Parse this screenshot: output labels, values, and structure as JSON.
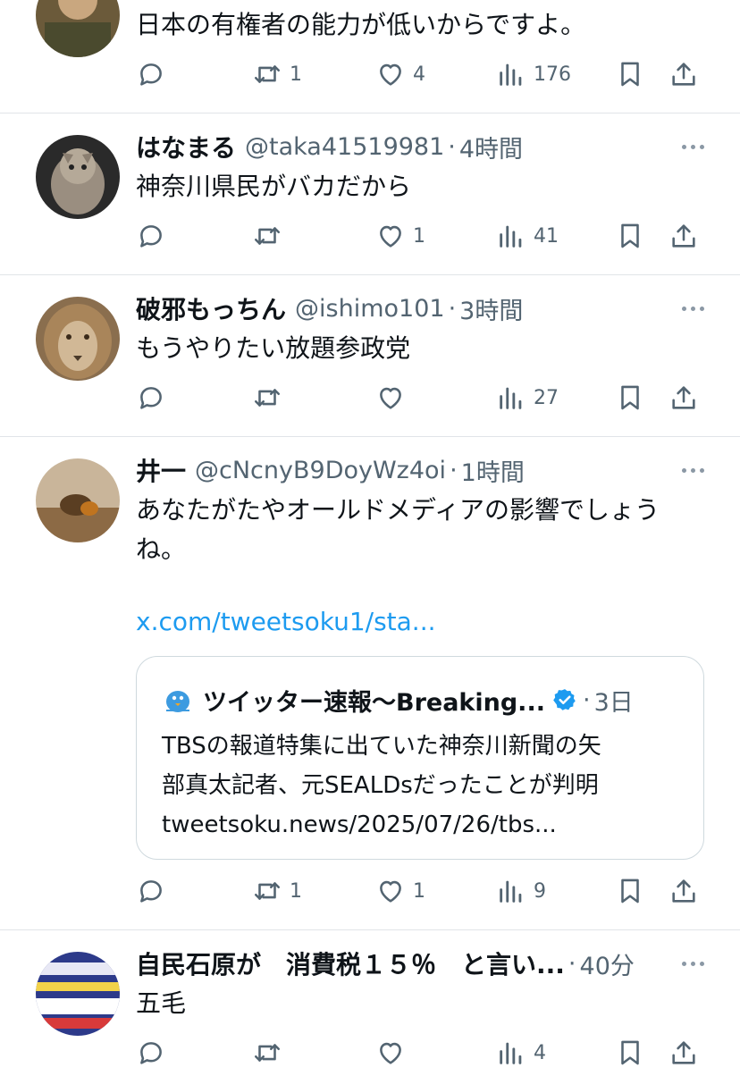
{
  "tweets": [
    {
      "name": "",
      "handle": "",
      "time": "",
      "text": "日本の有権者の能力が低いからですよ。",
      "reply": "",
      "retweets": "1",
      "likes": "4",
      "views": "176"
    },
    {
      "name": "はなまる",
      "handle": "@taka41519981",
      "time": "4時間",
      "text": "神奈川県民がバカだから",
      "reply": "",
      "retweets": "",
      "likes": "1",
      "views": "41"
    },
    {
      "name": "破邪もっちん",
      "handle": "@ishimo101",
      "time": "3時間",
      "text": "もうやりたい放題参政党",
      "reply": "",
      "retweets": "",
      "likes": "",
      "views": "27"
    },
    {
      "name": "井一",
      "handle": "@cNcnyB9DoyWz4oi",
      "time": "1時間",
      "text_line1": "あなたがたやオールドメディアの影響でしょう",
      "text_line2": "ね。",
      "link": "x.com/tweetsoku1/sta...",
      "quote": {
        "name": "ツイッター速報〜Breaking...",
        "time": "3日",
        "line1": "TBSの報道特集に出ていた神奈川新聞の矢",
        "line2": "部真太記者、元SEALDsだったことが判明",
        "line3": "tweetsoku.news/2025/07/26/tbs..."
      },
      "reply": "",
      "retweets": "1",
      "likes": "1",
      "views": "9"
    },
    {
      "name": "自民石原が　消費税１５％　と言い...",
      "handle": "",
      "time": "40分",
      "text": "五毛",
      "reply": "",
      "retweets": "",
      "likes": "",
      "views": "4"
    }
  ],
  "icons": {
    "reply": "reply-icon",
    "retweet": "retweet-icon",
    "like": "heart-icon",
    "views": "views-icon",
    "bookmark": "bookmark-icon",
    "share": "share-icon",
    "more": "more-icon",
    "verified": "verified-badge-icon"
  },
  "colors": {
    "text": "#0f1419",
    "muted": "#536471",
    "link": "#1d9bf0",
    "icon": "#536471",
    "verified": "#1d9bf0"
  }
}
